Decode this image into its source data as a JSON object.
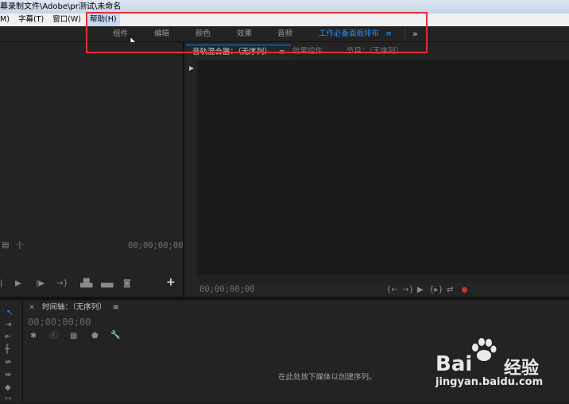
{
  "window": {
    "title": "幕录制文件\\Adobe\\pr测试\\未命名"
  },
  "menubar": {
    "items": [
      {
        "label": "M)",
        "highlighted": false
      },
      {
        "label": "字幕(T)",
        "highlighted": false
      },
      {
        "label": "窗口(W)",
        "highlighted": false
      },
      {
        "label": "帮助(H)",
        "highlighted": true
      }
    ]
  },
  "workspaces": {
    "items": [
      "组件",
      "编辑",
      "颜色",
      "效果",
      "音频",
      "工作必备面板排布"
    ],
    "active_index": 5,
    "menu_glyph": "≡",
    "overflow_glyph": "»",
    "active_color": "#2d8ceb"
  },
  "source_panel": {
    "timecode": "00;00;00;00"
  },
  "right_panel": {
    "tabs": [
      {
        "label": "音轨混合器：（无序列）",
        "active": true
      },
      {
        "label": "效果控件",
        "active": false
      },
      {
        "label": "节目：（无序列）",
        "active": false
      }
    ],
    "tab_menu_glyph": "≡",
    "timecode": "00;00;00;00"
  },
  "timeline": {
    "tab_close": "×",
    "tab_label": "时间轴：（无序列）",
    "tab_menu_glyph": "≡",
    "timecode": "00;00;00;00",
    "drop_hint": "在此处放下媒体以创建序列。"
  },
  "watermark": {
    "brand": "Bai",
    "brand_suffix": "经验",
    "url": "jingyan.baidu.com"
  },
  "accent": {
    "highlight_box": "#e0313a",
    "record": "#c0392b"
  }
}
